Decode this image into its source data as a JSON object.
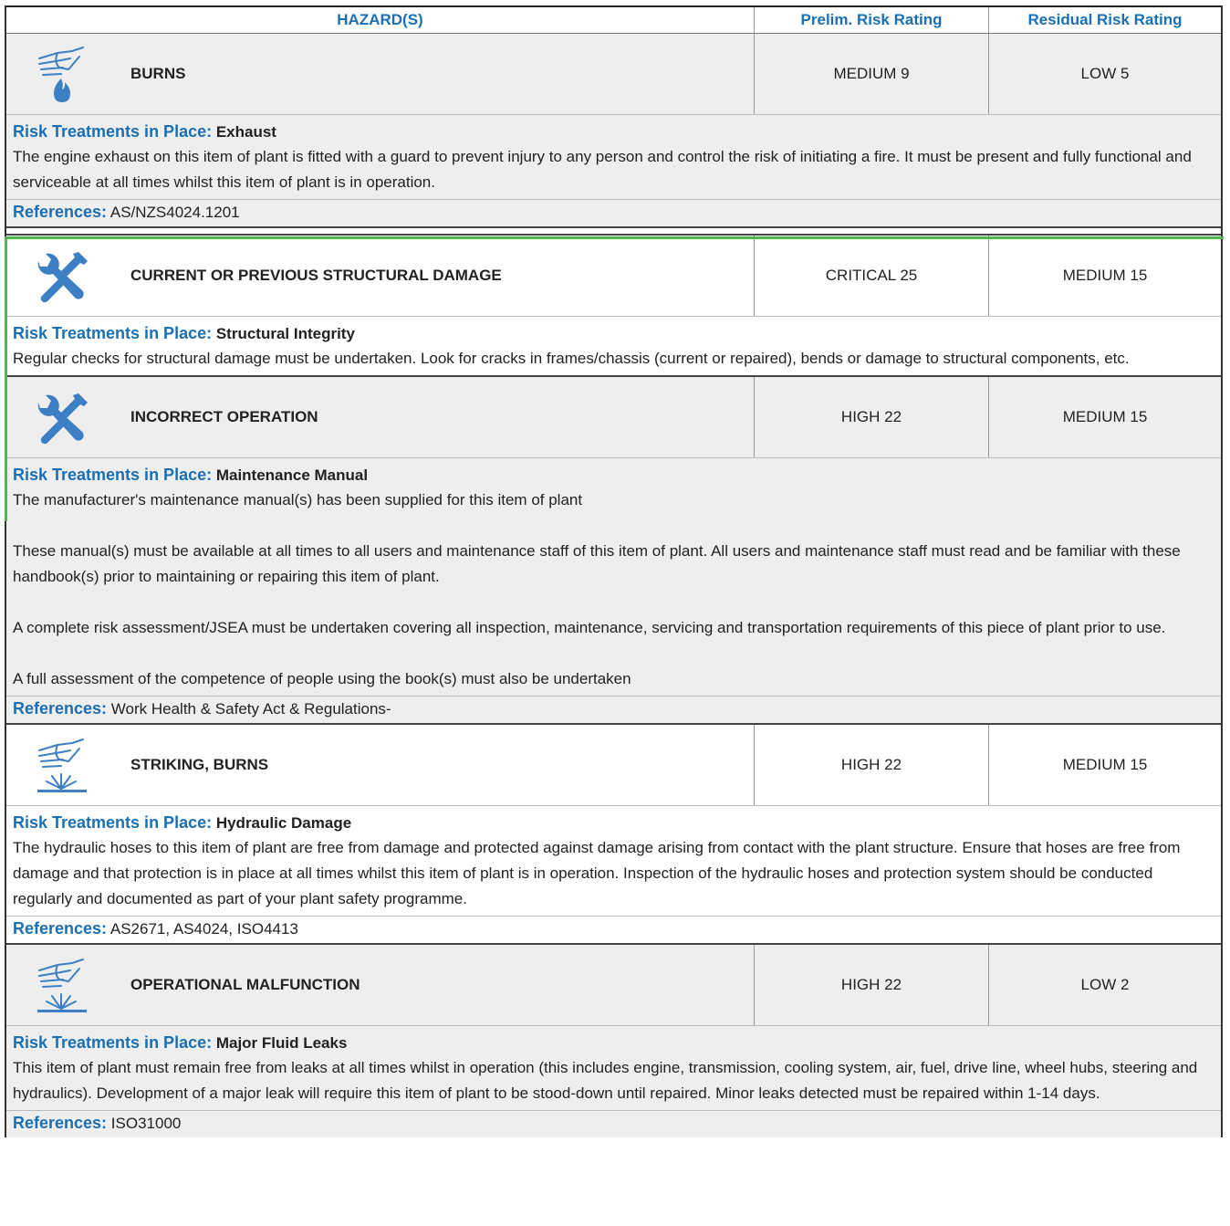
{
  "header": {
    "hazard": "HAZARD(S)",
    "prelim": "Prelim. Risk Rating",
    "residual": "Residual Risk Rating"
  },
  "labels": {
    "treatments": "Risk Treatments in Place:",
    "references": "References:"
  },
  "hazards": [
    {
      "icon": "hand-flame-icon",
      "name": "BURNS",
      "prelim": "MEDIUM 9",
      "residual": "LOW 5",
      "treatment_title": "Exhaust",
      "body": [
        "The engine exhaust on this item of plant is fitted with a guard to prevent injury to any person and control the risk of initiating a fire. It must be present and fully functional and serviceable at all times whilst this item of plant is in operation."
      ],
      "references": "AS/NZS4024.1201"
    },
    {
      "icon": "wrench-screwdriver-icon",
      "name": "CURRENT OR PREVIOUS STRUCTURAL DAMAGE",
      "prelim": "CRITICAL 25",
      "residual": "MEDIUM 15",
      "treatment_title": "Structural Integrity",
      "body": [
        "Regular checks for structural damage must be undertaken. Look for cracks in frames/chassis (current or repaired), bends or damage to structural components, etc."
      ],
      "references": null
    },
    {
      "icon": "wrench-screwdriver-icon",
      "name": "INCORRECT OPERATION",
      "prelim": "HIGH 22",
      "residual": "MEDIUM 15",
      "treatment_title": "Maintenance Manual",
      "body": [
        "The manufacturer's maintenance manual(s) has been supplied for this item of plant",
        "These manual(s) must be available at all times to all users and maintenance staff of this item of plant. All users and maintenance staff must read and be familiar with these handbook(s) prior to maintaining or repairing this item of plant.",
        "A complete risk assessment/JSEA must be undertaken covering all inspection, maintenance, servicing and transportation requirements of this piece of plant prior to use.",
        "A full assessment of the competence of people using the book(s) must also be undertaken"
      ],
      "references": "Work Health & Safety Act & Regulations-"
    },
    {
      "icon": "hand-spray-icon",
      "name": "STRIKING, BURNS",
      "prelim": "HIGH 22",
      "residual": "MEDIUM 15",
      "treatment_title": "Hydraulic Damage",
      "body": [
        "The hydraulic hoses to this item of plant are free from damage and protected against damage arising from contact with the plant structure. Ensure that hoses are free from damage and that  protection is in place at all times whilst this item of plant is in operation. Inspection of the hydraulic hoses and  protection system should be conducted regularly and documented as part of your plant safety programme."
      ],
      "references": "AS2671, AS4024, ISO4413"
    },
    {
      "icon": "hand-spray-icon",
      "name": "OPERATIONAL MALFUNCTION",
      "prelim": "HIGH 22",
      "residual": "LOW 2",
      "treatment_title": "Major Fluid Leaks",
      "body": [
        "This item of plant must remain free from leaks at all times whilst in operation (this includes engine, transmission, cooling system, air, fuel, drive line, wheel hubs, steering and hydraulics). Development of a major leak will require this item of plant to be stood-down until repaired. Minor leaks detected must be repaired within 1-14 days."
      ],
      "references": "ISO31000"
    }
  ],
  "colors": {
    "label_blue": "#1b6fb3",
    "icon_blue": "#3d7fc4",
    "highlight_green": "#4cb84c"
  }
}
